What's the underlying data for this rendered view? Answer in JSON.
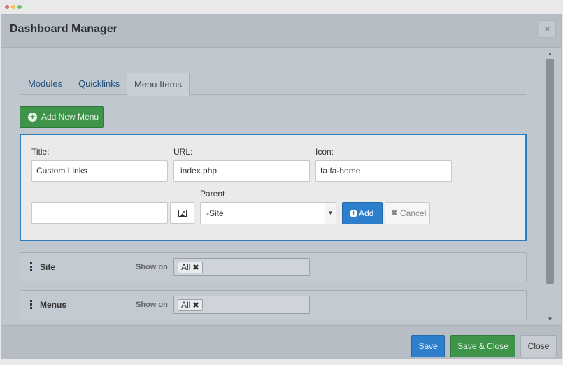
{
  "modal": {
    "title": "Dashboard Manager",
    "close_symbol": "×"
  },
  "tabs": [
    {
      "label": "Modules",
      "active": false
    },
    {
      "label": "Quicklinks",
      "active": false
    },
    {
      "label": "Menu Items",
      "active": true
    }
  ],
  "add_new_menu_label": "Add New Menu",
  "form": {
    "title_label": "Title:",
    "title_value": "Custom Links",
    "url_label": "URL:",
    "url_value": "index.php",
    "icon_label": "Icon:",
    "icon_value": "fa fa-home",
    "image_value": "",
    "parent_label": "Parent",
    "parent_selected": "-Site",
    "add_label": "Add",
    "cancel_label": "Cancel"
  },
  "menu_rows": [
    {
      "name": "Site",
      "show_on_label": "Show on",
      "tag": "All"
    },
    {
      "name": "Menus",
      "show_on_label": "Show on",
      "tag": "All"
    }
  ],
  "footer": {
    "save_label": "Save",
    "save_close_label": "Save & Close",
    "close_label": "Close"
  },
  "colors": {
    "primary": "#2d7fcb",
    "success": "#3e9448",
    "panel_border": "#2a7dc1"
  },
  "icons": {
    "add_menu": "plus-circle-icon",
    "add": "plus-circle-icon",
    "cancel": "times-icon",
    "image": "image-icon",
    "drag": "drag-handle-icon"
  }
}
